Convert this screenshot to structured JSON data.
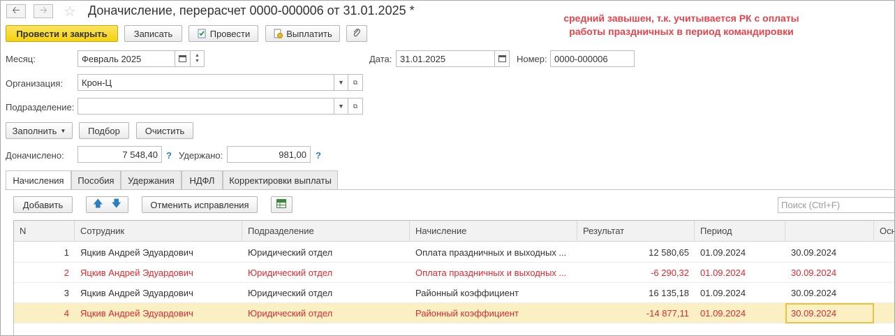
{
  "window": {
    "title": "Доначисление, перерасчет 0000-000006 от 31.01.2025 *",
    "annotation_line1": "средний завышен, т.к. учитывается РК с оплаты",
    "annotation_line2": "работы праздничных в период командировки"
  },
  "nav": {
    "back_icon": "arrow-left-icon",
    "forward_icon": "arrow-right-icon",
    "favorite_icon": "star-icon"
  },
  "toolbar": {
    "post_close": "Провести и закрыть",
    "save": "Записать",
    "post": "Провести",
    "pay": "Выплатить",
    "attach_icon": "paperclip-icon"
  },
  "form": {
    "month_label": "Месяц:",
    "month_value": "Февраль 2025",
    "date_label": "Дата:",
    "date_value": "31.01.2025",
    "number_label": "Номер:",
    "number_value": "0000-000006",
    "org_label": "Организация:",
    "org_value": "Крон-Ц",
    "dept_label": "Подразделение:",
    "dept_value": ""
  },
  "actions": {
    "fill": "Заполнить",
    "select": "Подбор",
    "clear": "Очистить"
  },
  "totals": {
    "accrued_label": "Доначислено:",
    "accrued_value": "7 548,40",
    "withheld_label": "Удержано:",
    "withheld_value": "981,00",
    "help": "?"
  },
  "tabs": [
    "Начисления",
    "Пособия",
    "Удержания",
    "НДФЛ",
    "Корректировки выплаты"
  ],
  "table_toolbar": {
    "add": "Добавить",
    "cancel_fix": "Отменить исправления",
    "search_placeholder": "Поиск (Ctrl+F)"
  },
  "table": {
    "columns": [
      "N",
      "Сотрудник",
      "Подразделение",
      "Начисление",
      "Результат",
      "Период",
      "",
      "Осн"
    ],
    "rows": [
      {
        "n": "1",
        "employee": "Яцкив Андрей Эдуардович",
        "dept": "Юридический отдел",
        "accrual": "Оплата праздничных и выходных ...",
        "result": "12 580,65",
        "period_from": "01.09.2024",
        "period_to": "30.09.2024",
        "status": "normal"
      },
      {
        "n": "2",
        "employee": "Яцкив Андрей Эдуардович",
        "dept": "Юридический отдел",
        "accrual": "Оплата праздничных и выходных ...",
        "result": "-6 290,32",
        "period_from": "01.09.2024",
        "period_to": "30.09.2024",
        "status": "reversal"
      },
      {
        "n": "3",
        "employee": "Яцкив Андрей Эдуардович",
        "dept": "Юридический отдел",
        "accrual": "Районный коэффициент",
        "result": "16 135,18",
        "period_from": "01.09.2024",
        "period_to": "30.09.2024",
        "status": "normal"
      },
      {
        "n": "4",
        "employee": "Яцкив Андрей Эдуардович",
        "dept": "Юридический отдел",
        "accrual": "Районный коэффициент",
        "result": "-14 877,11",
        "period_from": "01.09.2024",
        "period_to": "30.09.2024",
        "status": "reversal"
      }
    ]
  },
  "colors": {
    "accent": "#f5d20e",
    "reversal_text": "#e3282f",
    "annotation": "#e8434b",
    "selected_row": "#fbf0c4"
  }
}
